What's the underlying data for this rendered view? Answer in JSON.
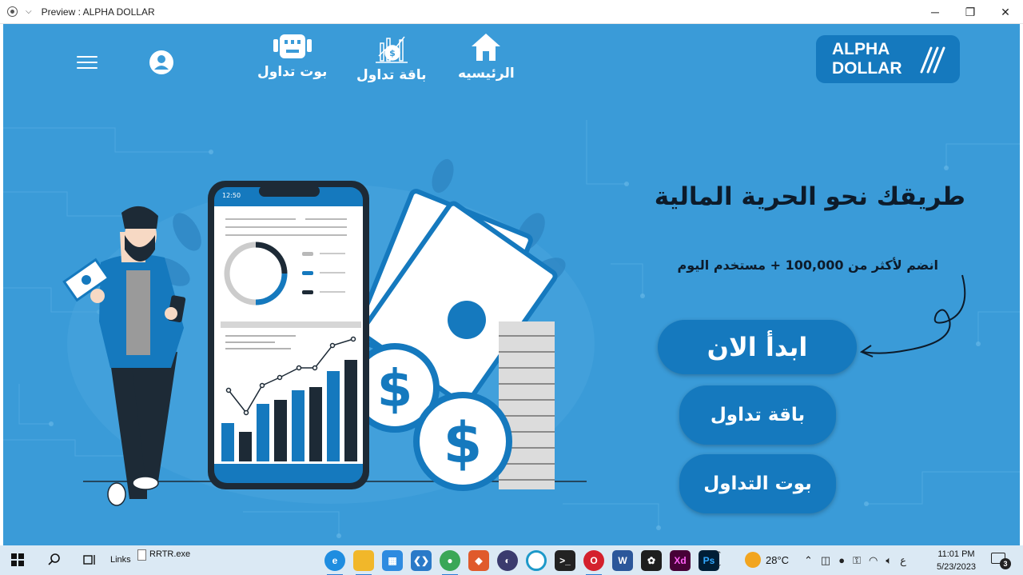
{
  "window": {
    "title": "Preview : ALPHA DOLLAR"
  },
  "nav": {
    "home_label": "الرئيسيه",
    "package_label": "باقة تداول",
    "bot_label": "بوت تداول"
  },
  "logo": {
    "line1": "ALPHA",
    "line2": "DOLLAR"
  },
  "hero": {
    "title": "طريقك نحو الحرية المالية",
    "subtitle": "انضم لأكثر من  100,000 + مستخدم اليوم",
    "start_button": "ابدأ الان",
    "package_button": "باقة تداول",
    "bot_button": "بوت التداول"
  },
  "illustration": {
    "phone_time": "12:50"
  },
  "taskbar": {
    "links_label": "Links",
    "file_label": "RRTR.exe",
    "temperature": "28°C",
    "language": "ع",
    "time": "11:01 PM",
    "date": "5/23/2023",
    "notifications": "3"
  },
  "colors": {
    "background": "#3a9bd8",
    "primary": "#1579be",
    "dark": "#0d1b2a"
  }
}
